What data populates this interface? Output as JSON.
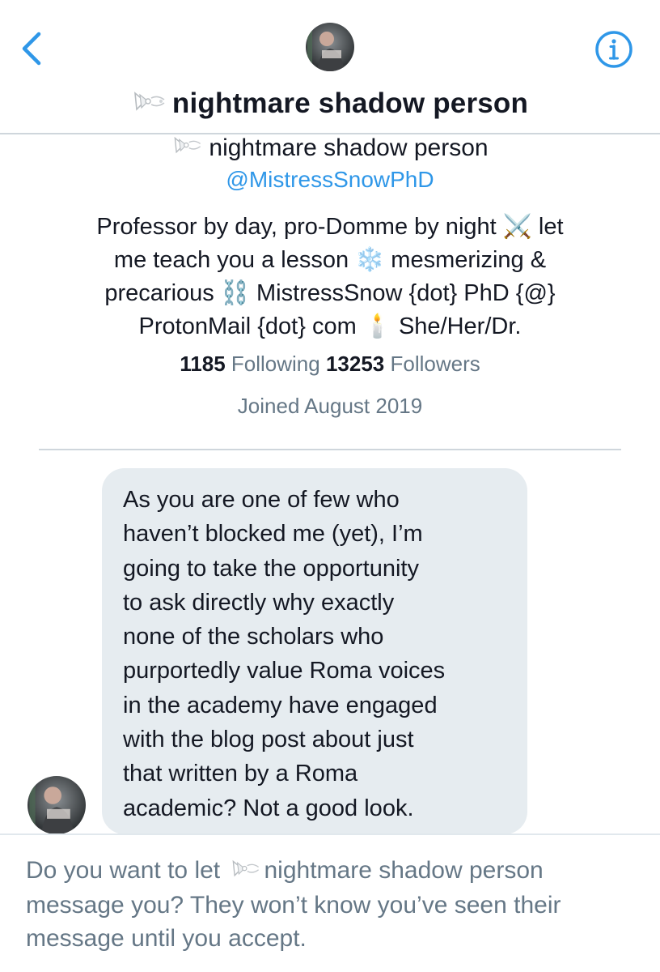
{
  "header": {
    "title_emoji": "🎀",
    "title_text": "nightmare shadow person",
    "back_icon": "chevron-left-icon",
    "info_icon": "info-circle-icon",
    "accent_color": "#2f97e8"
  },
  "profile": {
    "name_text": "nightmare shadow person",
    "handle": "@MistressSnowPhD",
    "bio_lines": [
      "Professor by day, pro-Domme by night ⚔️ let",
      "me teach you a lesson ❄️ mesmerizing &",
      "precarious ⛓️ MistressSnow {dot} PhD {@}",
      "ProtonMail {dot} com 🕯️ She/Her/Dr."
    ],
    "following_count": "1185",
    "following_label": "Following",
    "followers_count": "13253",
    "followers_label": "Followers",
    "joined": "Joined August 2019"
  },
  "message": {
    "lines": [
      "As you are one of few who",
      "haven’t blocked me (yet), I’m",
      "going to take the opportunity",
      "to ask directly why exactly",
      "none of the scholars who",
      "purportedly value Roma voices",
      "in the academy have engaged",
      "with the blog post about just",
      "that written by a Roma",
      "academic? Not a good look."
    ]
  },
  "request_prompt": {
    "prefix": "Do you want to let",
    "name_text": "nightmare shadow person",
    "line2": "message you? They won’t know you’ve seen their",
    "line3": "message until you accept."
  }
}
